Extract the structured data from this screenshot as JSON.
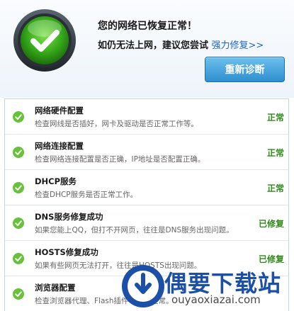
{
  "header": {
    "title": "您的网络已恢复正常！",
    "subtitle_prefix": "如仍无法上网，建议您尝试 ",
    "repair_link": "强力修复>>",
    "rediagnose_label": "重新诊断"
  },
  "colors": {
    "accent": "#2f8fd0",
    "ok_green": "#2e8b1a",
    "check_green": "#67c23a",
    "link_blue": "#1f63c6",
    "watermark_blue": "#1b4fa8"
  },
  "items": [
    {
      "icon": "check-icon",
      "name": "网络硬件配置",
      "desc": "检查网线是否插好，网卡及驱动是否正常工作等。",
      "state": "正常"
    },
    {
      "icon": "check-icon",
      "name": "网络连接配置",
      "desc": "检查网络连接配置是否正确，IP地址是否配置正确。",
      "state": "正常"
    },
    {
      "icon": "check-icon",
      "name": "DHCP服务",
      "desc": "检查DHCP服务是否正常工作。",
      "state": "正常"
    },
    {
      "icon": "check-icon",
      "name": "DNS服务修复成功",
      "desc": "如果您能上QQ，但打不开网页，往往是DNS服务出现问题。",
      "state": "已修复"
    },
    {
      "icon": "check-icon",
      "name": "HOSTS修复成功",
      "desc": "如果有些网页无法打开，往往是HOSTS出现问题。",
      "state": "已修复"
    },
    {
      "icon": "check-icon",
      "name": "浏览器配置",
      "desc": "检查浏览器代理、Flash插件等是否正常。",
      "state": ""
    }
  ],
  "watermark": {
    "text": "偶要下载站",
    "url": "ouyaoxiazai.com"
  }
}
